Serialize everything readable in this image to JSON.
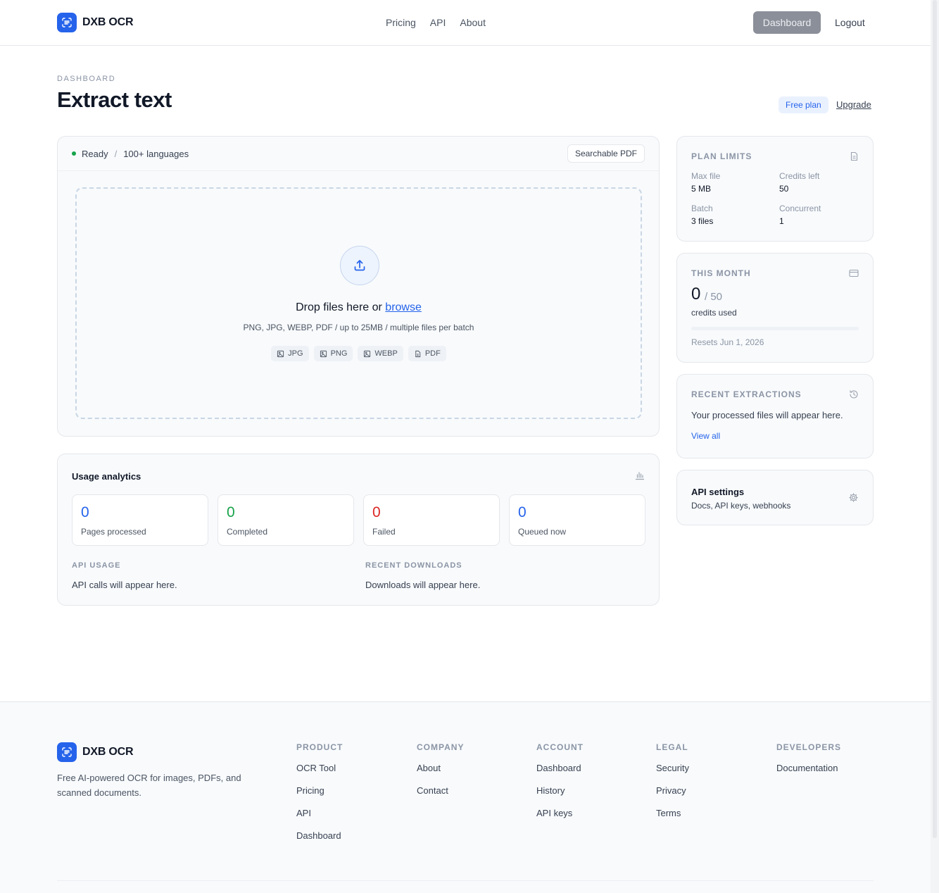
{
  "header": {
    "brand": "DXB OCR",
    "nav": [
      "Pricing",
      "API",
      "About"
    ],
    "dashboard_label": "Dashboard",
    "logout_label": "Logout"
  },
  "page": {
    "eyebrow": "DASHBOARD",
    "title": "Extract text",
    "plan_badge": "Free plan",
    "upgrade_label": "Upgrade"
  },
  "upload": {
    "status": "Ready",
    "separator": "/",
    "languages": "100+ languages",
    "searchable_pdf_label": "Searchable PDF",
    "drop_text": "Drop files here or ",
    "browse_label": "browse",
    "formats_text": "PNG, JPG, WEBP, PDF / up to 25MB / multiple files per batch",
    "chips": [
      {
        "label": "JPG",
        "icon": "image-icon"
      },
      {
        "label": "PNG",
        "icon": "image-icon"
      },
      {
        "label": "WEBP",
        "icon": "image-icon"
      },
      {
        "label": "PDF",
        "icon": "document-icon"
      }
    ]
  },
  "analytics": {
    "title": "Usage analytics",
    "stats": [
      {
        "value": "0",
        "label": "Pages processed",
        "color": "#2563eb"
      },
      {
        "value": "0",
        "label": "Completed",
        "color": "#16a34a"
      },
      {
        "value": "0",
        "label": "Failed",
        "color": "#dc2626"
      },
      {
        "value": "0",
        "label": "Queued now",
        "color": "#2563eb"
      }
    ],
    "api_usage_head": "API USAGE",
    "api_usage_text": "API calls will appear here.",
    "downloads_head": "RECENT DOWNLOADS",
    "downloads_text": "Downloads will appear here."
  },
  "plan_limits": {
    "head": "PLAN LIMITS",
    "max_file_label": "Max file",
    "max_file_value": "5 MB",
    "credits_left_label": "Credits left",
    "credits_left_value": "50",
    "batch_label": "Batch",
    "batch_value": "3 files",
    "concurrent_label": "Concurrent",
    "concurrent_value": "1"
  },
  "this_month": {
    "head": "THIS MONTH",
    "used": "0",
    "total": "/ 50",
    "used_label": "credits used",
    "progress_fraction": 0,
    "resets": "Resets Jun 1, 2026"
  },
  "recent": {
    "head": "RECENT EXTRACTIONS",
    "empty": "Your processed files will appear here.",
    "view_all": "View all"
  },
  "api_settings": {
    "title": "API settings",
    "subtitle": "Docs, API keys, webhooks"
  },
  "footer": {
    "brand": "DXB OCR",
    "description": "Free AI-powered OCR for images, PDFs, and scanned documents.",
    "columns": [
      {
        "head": "PRODUCT",
        "links": [
          "OCR Tool",
          "Pricing",
          "API",
          "Dashboard"
        ]
      },
      {
        "head": "COMPANY",
        "links": [
          "About",
          "Contact"
        ]
      },
      {
        "head": "ACCOUNT",
        "links": [
          "Dashboard",
          "History",
          "API keys"
        ]
      },
      {
        "head": "LEGAL",
        "links": [
          "Security",
          "Privacy",
          "Terms"
        ]
      },
      {
        "head": "DEVELOPERS",
        "links": [
          "Documentation"
        ]
      }
    ]
  },
  "colors": {
    "accent": "#2563eb",
    "success": "#16a34a",
    "danger": "#dc2626"
  }
}
